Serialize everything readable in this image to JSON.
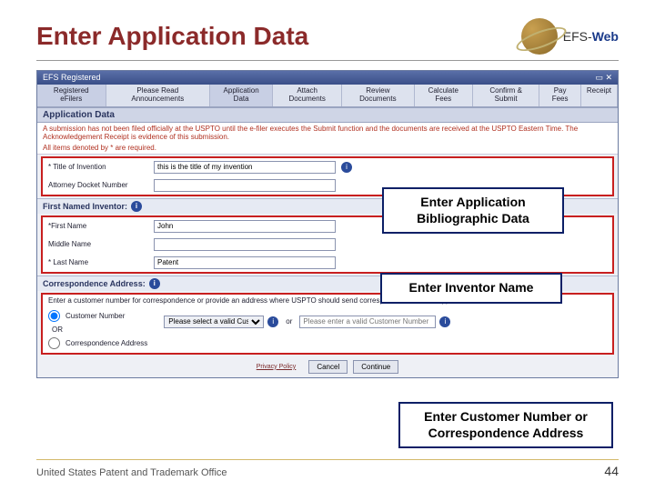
{
  "slide": {
    "title": "Enter Application Data",
    "logo_text_prefix": "EFS-",
    "logo_text_suffix": "Web"
  },
  "app": {
    "window_title": "EFS Registered",
    "menubar_left": "Registered\neFilers",
    "tabs": [
      "Please Read\nAnnouncements",
      "Application\nData",
      "Attach\nDocuments",
      "Review\nDocuments",
      "Calculate\nFees",
      "Confirm &\nSubmit",
      "Pay\nFees",
      "Receipt"
    ],
    "section_title": "Application Data",
    "notice": "A submission has not been filed officially at the USPTO until the e-filer executes the Submit function and the documents are received at the USPTO Eastern Time. The Acknowledgement Receipt is evidence of this submission.",
    "required_note": "All items denoted by * are required.",
    "fields": {
      "title_label": "* Title of Invention",
      "title_value": "this is the title of my invention",
      "docket_label": "Attorney Docket Number",
      "docket_value": ""
    },
    "inventor": {
      "header": "First Named Inventor:",
      "first_label": "*First Name",
      "first_value": "John",
      "middle_label": "Middle Name",
      "middle_value": "",
      "last_label": "* Last Name",
      "last_value": "Patent"
    },
    "corr": {
      "header": "Correspondence Address:",
      "instruction": "Enter a customer number for correspondence or provide an address where USPTO should send correspondence for this application.",
      "radio_cn": "Customer Number",
      "or_divider": "OR",
      "radio_ca": "Correspondence Address",
      "select_placeholder": "Please select a valid Customer Number",
      "or_small": "or",
      "input_placeholder": "Please enter a valid Customer Number"
    },
    "buttons": {
      "privacy": "Privacy Policy",
      "cancel": "Cancel",
      "continue": "Continue"
    }
  },
  "callouts": {
    "c1": "Enter Application Bibliographic Data",
    "c2": "Enter Inventor Name",
    "c3": "Enter Customer Number or Correspondence Address"
  },
  "footer": {
    "org": "United States Patent and Trademark Office",
    "page": "44"
  }
}
